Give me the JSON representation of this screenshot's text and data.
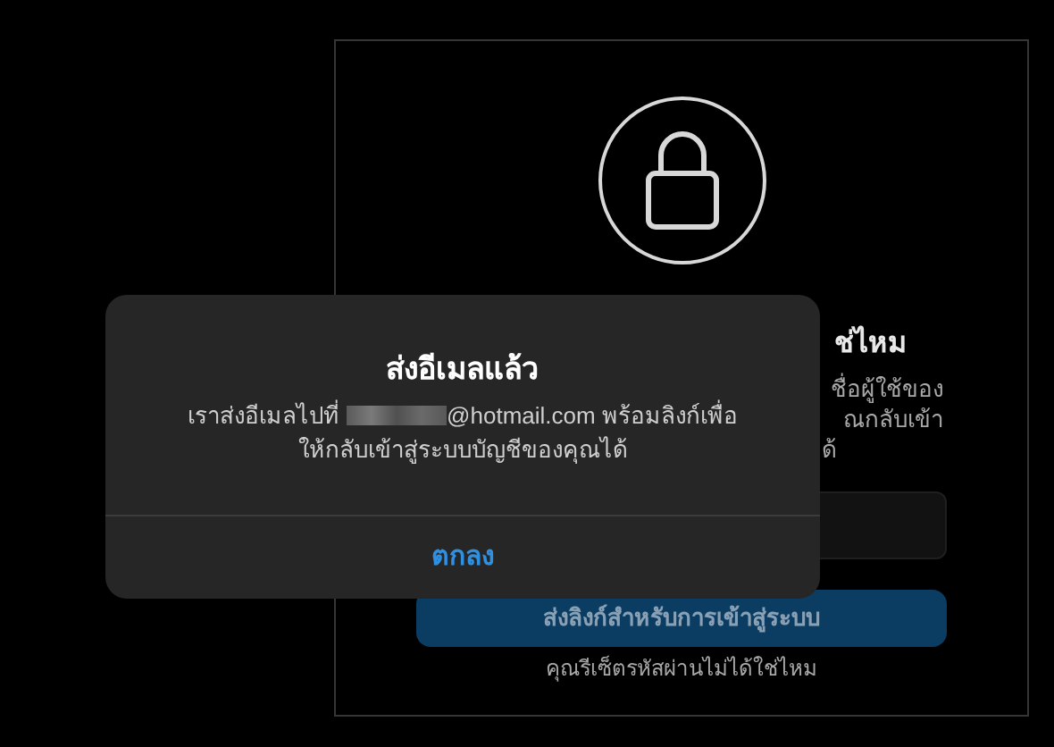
{
  "background_card": {
    "title_visible": "ช่ไหม",
    "description_lines": [
      "ชื่อผู้ใช้ของ",
      "ณกลับเข้า",
      "ด้"
    ],
    "submit_button": "ส่งลิงก์สำหรับการเข้าสู่ระบบ",
    "link": "คุณรีเซ็ตรหัสผ่านไม่ได้ใช่ไหม"
  },
  "dialog": {
    "title": "ส่งอีเมลแล้ว",
    "message_start": "เราส่งอีเมลไปที่",
    "message_after_redaction": "@hotmail.com พร้อมลิงก์เพื่อ",
    "message_line_2": "ให้กลับเข้าสู่ระบบบัญชีของคุณได้",
    "ok_button": "ตกลง"
  }
}
